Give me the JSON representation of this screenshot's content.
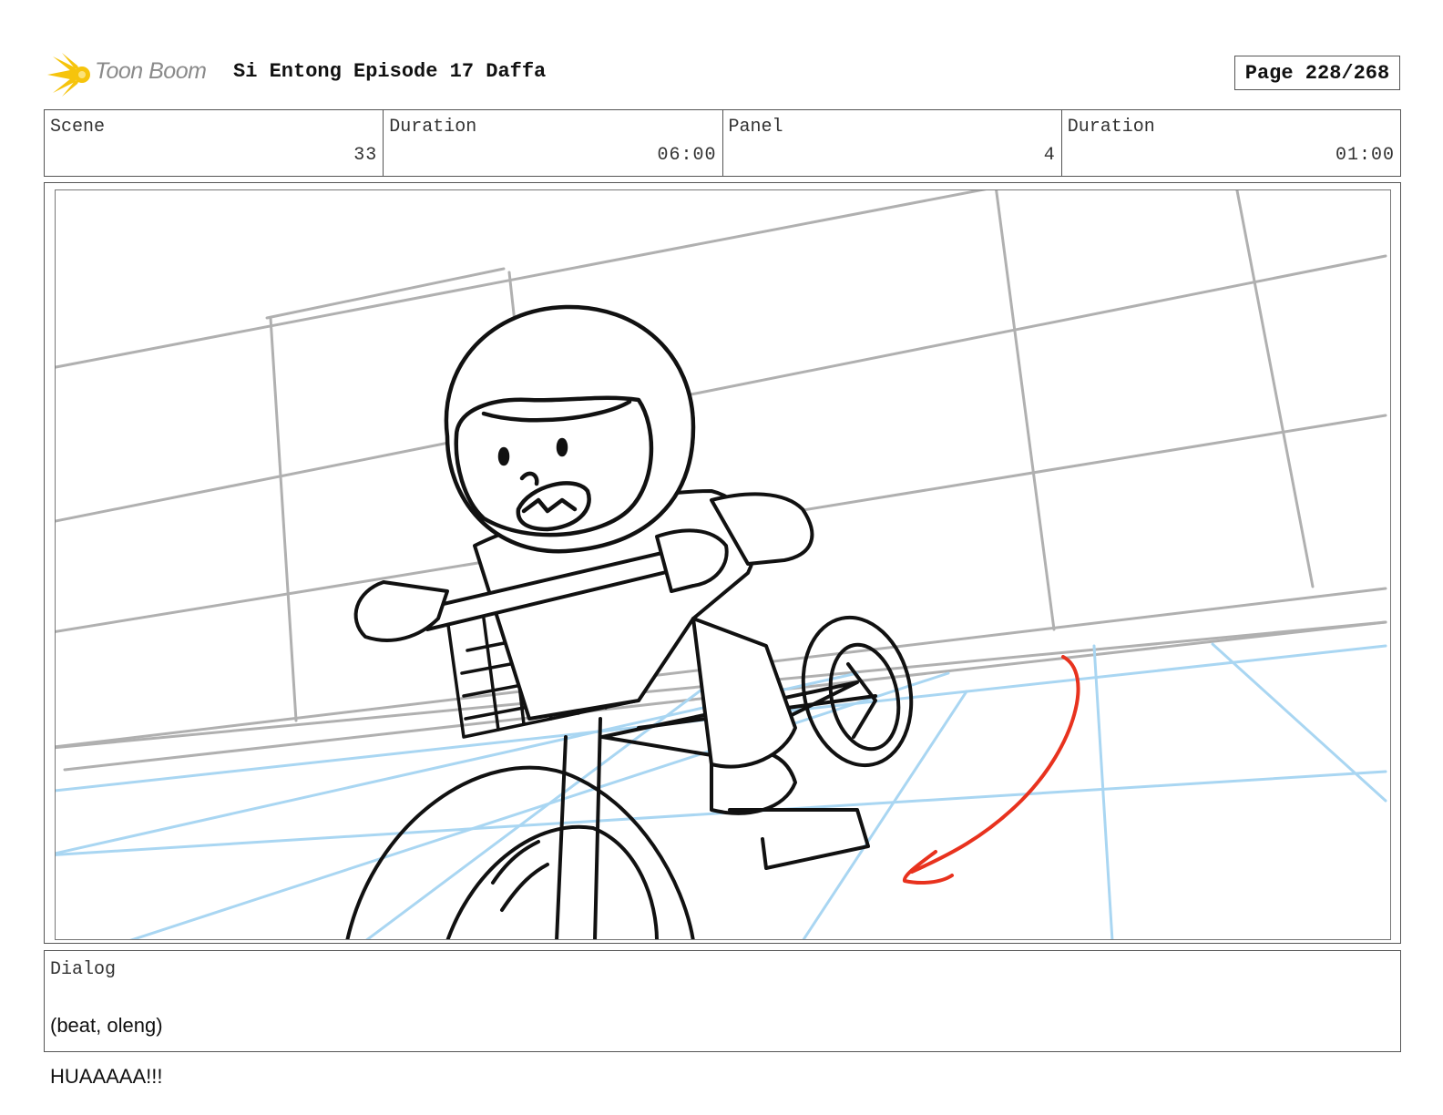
{
  "header": {
    "logo_text": "Toon Boom",
    "title": "Si Entong Episode 17 Daffa",
    "page_label": "Page 228/268"
  },
  "info": {
    "scene_label": "Scene",
    "scene_value": "33",
    "scene_duration_label": "Duration",
    "scene_duration_value": "06:00",
    "panel_label": "Panel",
    "panel_value": "4",
    "panel_duration_label": "Duration",
    "panel_duration_value": "01:00"
  },
  "panel": {
    "icon": "storyboard-sketch-child-on-bicycle",
    "colors": {
      "guide_gray": "#b0b0b0",
      "guide_blue": "#a9d6f2",
      "ink": "#111111",
      "arrow_red": "#e8321e"
    }
  },
  "dialog": {
    "label": "Dialog",
    "line1": "(beat, oleng)",
    "line2": "HUAAAAA!!!"
  },
  "brand": {
    "logo_color": "#f6c40c"
  }
}
